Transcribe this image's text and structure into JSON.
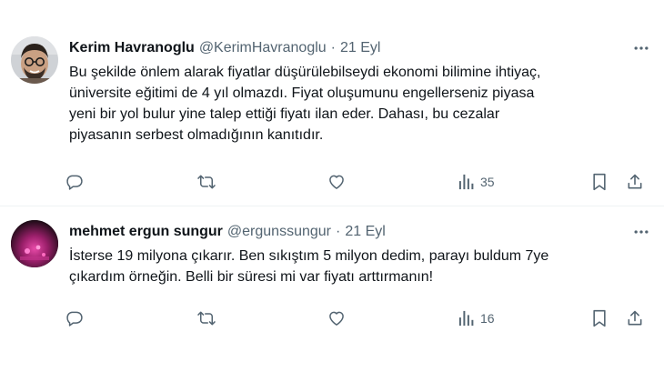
{
  "tweets": [
    {
      "author_name": "Kerim Havranoglu",
      "handle": "@KerimHavranoglu",
      "separator": "·",
      "date": "21 Eyl",
      "lines": [
        "Bu şekilde önlem alarak fiyatlar düşürülebilseydi ekonomi bilimine ihtiyaç,",
        "üniversite eğitimi de 4 yıl olmazdı. Fiyat oluşumunu engellerseniz piyasa",
        "yeni bir yol bulur yine talep ettiği fiyatı ilan eder. Dahası, bu cezalar",
        "piyasanın serbest olmadığının kanıtıdır."
      ],
      "views": "35",
      "icons": {
        "more": "more-horizontal-icon",
        "reply": "reply-icon",
        "retweet": "retweet-icon",
        "like": "heart-icon",
        "views": "views-bar-chart-icon",
        "bookmark": "bookmark-icon",
        "share": "share-icon"
      }
    },
    {
      "author_name": "mehmet ergun sungur",
      "handle": "@ergunssungur",
      "separator": "·",
      "date": "21 Eyl",
      "lines": [
        "İsterse 19 milyona çıkarır. Ben sıkıştım 5 milyon dedim, parayı buldum 7ye",
        "çıkardım örneğin. Belli bir süresi mi var fiyatı arttırmanın!"
      ],
      "views": "16",
      "icons": {
        "more": "more-horizontal-icon",
        "reply": "reply-icon",
        "retweet": "retweet-icon",
        "like": "heart-icon",
        "views": "views-bar-chart-icon",
        "bookmark": "bookmark-icon",
        "share": "share-icon"
      }
    }
  ],
  "colors": {
    "text_primary": "#0f1419",
    "text_secondary": "#536471",
    "divider": "#eff3f4",
    "background": "#ffffff"
  }
}
